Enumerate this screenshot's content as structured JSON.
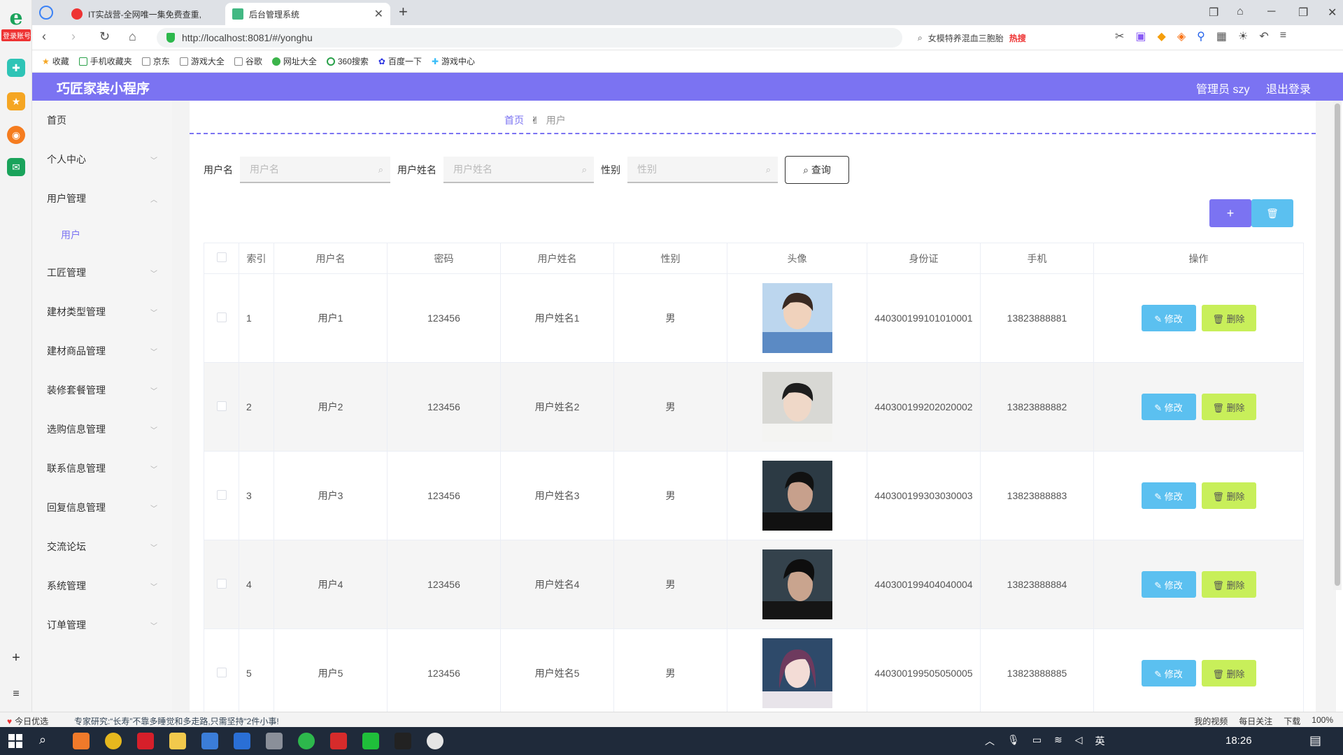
{
  "browser": {
    "dock_badge": "登录账号",
    "tabs": [
      {
        "title": "IT实战营-全网唯一集免费查重,",
        "icon": "it-icon"
      },
      {
        "title": "后台管理系统",
        "icon": "vue-icon"
      }
    ],
    "url": "http://localhost:8081/#/yonghu",
    "search_text": "女模特养混血三胞胎",
    "search_hot": "热搜",
    "bookmarks": [
      "收藏",
      "手机收藏夹",
      "京东",
      "游戏大全",
      "谷歌",
      "网址大全",
      "360搜索",
      "百度一下",
      "游戏中心"
    ]
  },
  "app": {
    "title": "巧匠家装小程序",
    "user": "管理员 szy",
    "logout": "退出登录"
  },
  "sidebar": {
    "items": [
      {
        "label": "首页",
        "arrow": false
      },
      {
        "label": "个人中心",
        "arrow": true
      },
      {
        "label": "用户管理",
        "arrow": true
      },
      {
        "label": "工匠管理",
        "arrow": true
      },
      {
        "label": "建材类型管理",
        "arrow": true
      },
      {
        "label": "建材商品管理",
        "arrow": true
      },
      {
        "label": "装修套餐管理",
        "arrow": true
      },
      {
        "label": "选购信息管理",
        "arrow": true
      },
      {
        "label": "联系信息管理",
        "arrow": true
      },
      {
        "label": "回复信息管理",
        "arrow": true
      },
      {
        "label": "交流论坛",
        "arrow": true
      },
      {
        "label": "系统管理",
        "arrow": true
      },
      {
        "label": "订单管理",
        "arrow": true
      }
    ],
    "sub_item": "用户"
  },
  "breadcrumb": {
    "home": "首页",
    "current": "用户"
  },
  "search": {
    "fields": [
      {
        "label": "用户名",
        "placeholder": "用户名"
      },
      {
        "label": "用户姓名",
        "placeholder": "用户姓名"
      },
      {
        "label": "性别",
        "placeholder": "性别"
      }
    ],
    "query_label": "查询"
  },
  "actions": {
    "add": "+",
    "delete_icon": "trash-icon"
  },
  "table": {
    "headers": [
      "索引",
      "用户名",
      "密码",
      "用户姓名",
      "性别",
      "头像",
      "身份证",
      "手机",
      "操作"
    ],
    "edit_label": "修改",
    "delete_label": "删除",
    "rows": [
      {
        "index": "1",
        "username": "用户1",
        "password": "123456",
        "name": "用户姓名1",
        "gender": "男",
        "idcard": "440300199101010001",
        "phone": "13823888881",
        "avatar": "avatar-1"
      },
      {
        "index": "2",
        "username": "用户2",
        "password": "123456",
        "name": "用户姓名2",
        "gender": "男",
        "idcard": "440300199202020002",
        "phone": "13823888882",
        "avatar": "avatar-2"
      },
      {
        "index": "3",
        "username": "用户3",
        "password": "123456",
        "name": "用户姓名3",
        "gender": "男",
        "idcard": "440300199303030003",
        "phone": "13823888883",
        "avatar": "avatar-3"
      },
      {
        "index": "4",
        "username": "用户4",
        "password": "123456",
        "name": "用户姓名4",
        "gender": "男",
        "idcard": "440300199404040004",
        "phone": "13823888884",
        "avatar": "avatar-4"
      },
      {
        "index": "5",
        "username": "用户5",
        "password": "123456",
        "name": "用户姓名5",
        "gender": "男",
        "idcard": "440300199505050005",
        "phone": "13823888885",
        "avatar": "avatar-5"
      }
    ]
  },
  "statusbar": {
    "left1": "今日优选",
    "left2": "专家研究:“长寿”不靠多睡觉和多走路,只需坚持“2件小事!",
    "right": [
      "我的视频",
      "每日关注",
      "下载",
      "100%"
    ]
  },
  "taskbar": {
    "time": "18:26",
    "lang": "英"
  },
  "colors": {
    "primary": "#7b73f2",
    "edit": "#5bc0f0",
    "delete": "#c8ef5a"
  }
}
